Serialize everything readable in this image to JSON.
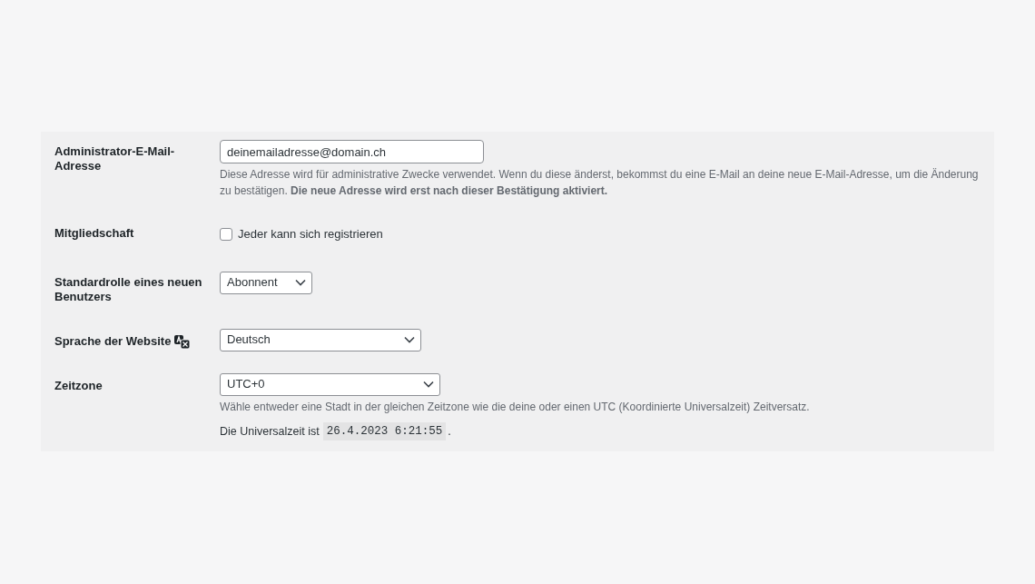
{
  "rows": [
    {
      "kind": "email",
      "label": "Administrator-E-Mail-Adresse",
      "value": "deinemailadresse@domain.ch",
      "description": "Diese Adresse wird für administrative Zwecke verwendet. Wenn du diese änderst, bekommst du eine E-Mail an deine neue E-Mail-Adresse, um die Änderung zu bestätigen. **Die neue Adresse wird erst nach dieser Bestätigung aktiviert.**"
    },
    {
      "kind": "checkbox",
      "label": "Mitgliedschaft",
      "option": "Jeder kann sich registrieren",
      "checked": false
    },
    {
      "kind": "select",
      "label": "Standardrolle eines neuen Benutzers",
      "value": "Abonnent"
    },
    {
      "kind": "select",
      "label": "Sprache der Website",
      "translation_icon": true,
      "value": "Deutsch"
    },
    {
      "kind": "select",
      "label": "Zeitzone",
      "value": "UTC+0",
      "description": "Wähle entweder eine Stadt in der gleichen Zeitzone wie die deine oder einen UTC (Koordinierte Universalzeit) Zeitversatz.",
      "time_prefix": "Die Universalzeit ist",
      "time": "26.4.2023 6:21:55",
      "time_suffix": "."
    }
  ]
}
